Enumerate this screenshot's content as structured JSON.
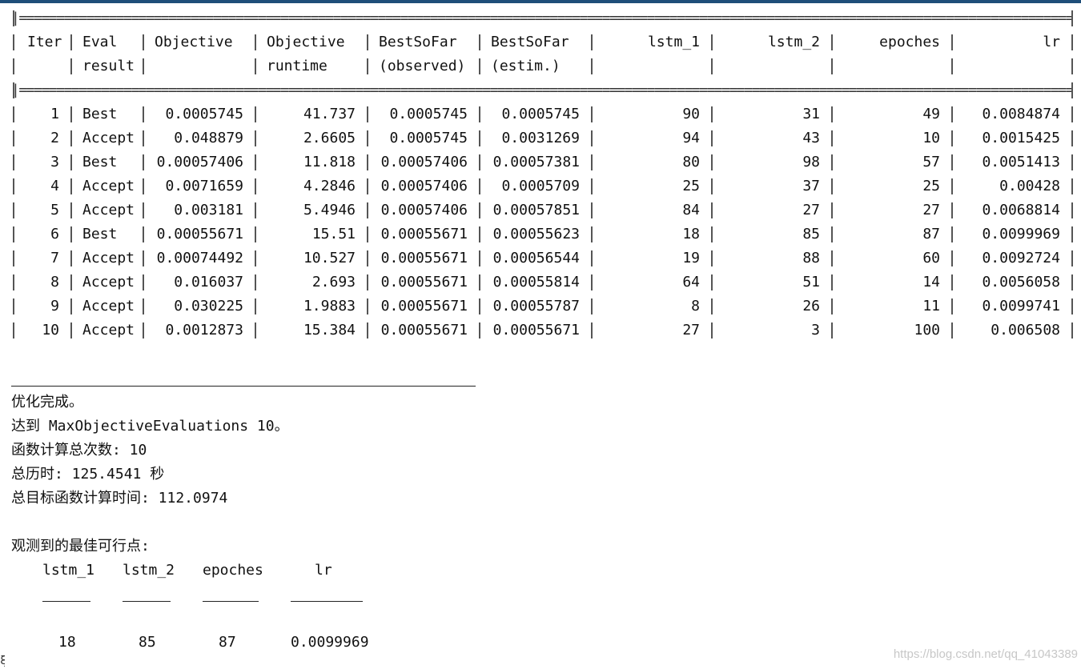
{
  "table": {
    "header_rows": [
      [
        "Iter",
        "Eval",
        "Objective",
        "Objective",
        "BestSoFar",
        "BestSoFar",
        "lstm_1",
        "lstm_2",
        "epoches",
        "lr"
      ],
      [
        "",
        "result",
        "",
        "runtime",
        "(observed)",
        "(estim.)",
        "",
        "",
        "",
        ""
      ]
    ],
    "rows": [
      [
        "1",
        "Best",
        "0.0005745",
        "41.737",
        "0.0005745",
        "0.0005745",
        "90",
        "31",
        "49",
        "0.0084874"
      ],
      [
        "2",
        "Accept",
        "0.048879",
        "2.6605",
        "0.0005745",
        "0.0031269",
        "94",
        "43",
        "10",
        "0.0015425"
      ],
      [
        "3",
        "Best",
        "0.00057406",
        "11.818",
        "0.00057406",
        "0.00057381",
        "80",
        "98",
        "57",
        "0.0051413"
      ],
      [
        "4",
        "Accept",
        "0.0071659",
        "4.2846",
        "0.00057406",
        "0.0005709",
        "25",
        "37",
        "25",
        "0.00428"
      ],
      [
        "5",
        "Accept",
        "0.003181",
        "5.4946",
        "0.00057406",
        "0.00057851",
        "84",
        "27",
        "27",
        "0.0068814"
      ],
      [
        "6",
        "Best",
        "0.00055671",
        "15.51",
        "0.00055671",
        "0.00055623",
        "18",
        "85",
        "87",
        "0.0099969"
      ],
      [
        "7",
        "Accept",
        "0.00074492",
        "10.527",
        "0.00055671",
        "0.00056544",
        "19",
        "88",
        "60",
        "0.0092724"
      ],
      [
        "8",
        "Accept",
        "0.016037",
        "2.693",
        "0.00055671",
        "0.00055814",
        "64",
        "51",
        "14",
        "0.0056058"
      ],
      [
        "9",
        "Accept",
        "0.030225",
        "1.9883",
        "0.00055671",
        "0.00055787",
        "8",
        "26",
        "11",
        "0.0099741"
      ],
      [
        "10",
        "Accept",
        "0.0012873",
        "15.384",
        "0.00055671",
        "0.00055671",
        "27",
        "3",
        "100",
        "0.006508"
      ]
    ]
  },
  "summary": {
    "line1": "优化完成。",
    "line2": "达到 MaxObjectiveEvaluations 10。",
    "line3": "函数计算总次数: 10",
    "line4": "总历时: 125.4541 秒",
    "line5": "总目标函数计算时间: 112.0974",
    "best_label": "观测到的最佳可行点:",
    "best_headers": [
      "lstm_1",
      "lstm_2",
      "epoches",
      "lr"
    ],
    "best_values": [
      "18",
      "85",
      "87",
      "0.0099969"
    ]
  },
  "watermark": "https://blog.csdn.net/qq_41043389",
  "colors": {
    "top_bar": "#1f4e79",
    "text": "#111111",
    "watermark": "#c7c7c7"
  }
}
